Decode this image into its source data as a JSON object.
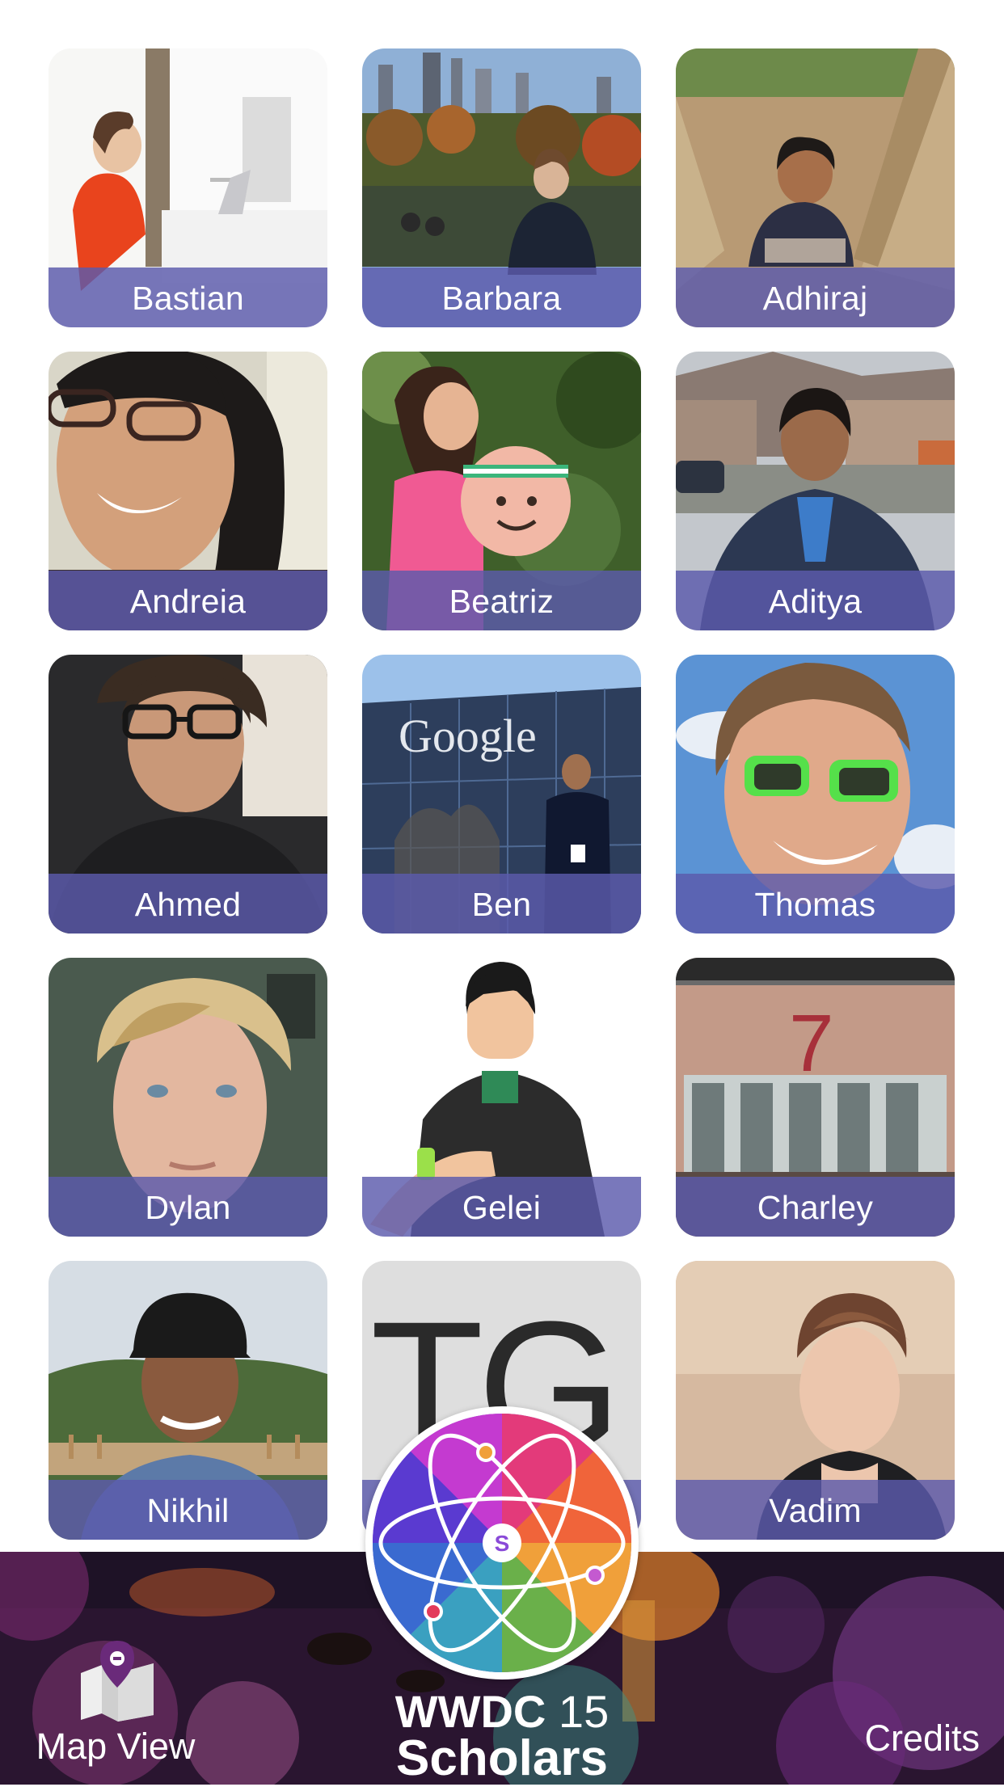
{
  "scholars": [
    {
      "name": "Bastian"
    },
    {
      "name": "Barbara"
    },
    {
      "name": "Adhiraj"
    },
    {
      "name": "Andreia"
    },
    {
      "name": "Beatriz"
    },
    {
      "name": "Aditya"
    },
    {
      "name": "Ahmed"
    },
    {
      "name": "Ben"
    },
    {
      "name": "Thomas"
    },
    {
      "name": "Dylan"
    },
    {
      "name": "Gelei"
    },
    {
      "name": "Charley"
    },
    {
      "name": "Nikhil"
    },
    {
      "name": "",
      "placeholder_initials": "TG"
    },
    {
      "name": "Vadim"
    }
  ],
  "photo_texts": {
    "google_sign": "Google",
    "stage_number": "7"
  },
  "footer": {
    "brand_wwdc": "WWDC",
    "brand_year": "15",
    "brand_scholars": "Scholars",
    "logo_letter": "S",
    "map_view_label": "Map View",
    "credits_label": "Credits"
  },
  "colors": {
    "name_bar": "#5c5aac",
    "footer_bg": "#2b1530"
  },
  "icons": {
    "map": "map-pin-icon",
    "logo": "atom-logo"
  }
}
